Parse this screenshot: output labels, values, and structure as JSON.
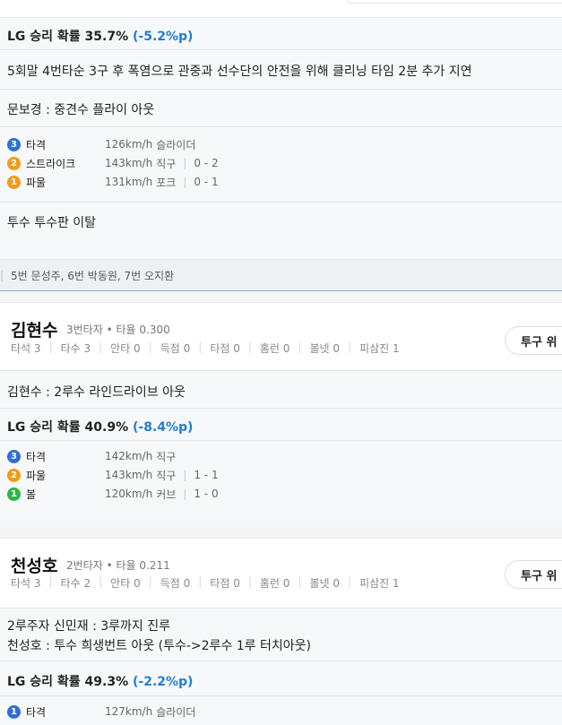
{
  "top_panel": {
    "win_prob": {
      "label": "LG 승리 확률 35.7%",
      "change": "(-5.2%p)"
    },
    "delay_note": "5회말 4번타순 3구 후 폭염으로 관중과 선수단의 안전을 위해 클리닝 타임 2분 추가 지연",
    "play_result": "문보경 : 중견수 플라이 아웃",
    "pitches": [
      {
        "num": "3",
        "color": "#2f6fd6",
        "result": "타격",
        "speed": "126km/h",
        "type": "슬라이더",
        "count": ""
      },
      {
        "num": "2",
        "color": "#f39a17",
        "result": "스트라이크",
        "speed": "143km/h",
        "type": "직구",
        "count": "0 - 2"
      },
      {
        "num": "1",
        "color": "#f39a17",
        "result": "파울",
        "speed": "131km/h",
        "type": "포크",
        "count": "0 - 1"
      }
    ],
    "pitcher_note": "투수 투수판 이탈",
    "footer_lineup": "5번 문성주, 6번 박동원, 7번 오지환"
  },
  "batters": [
    {
      "name": "김현수",
      "meta": "3번타자 • 타율 0.300",
      "stats": [
        "타석 3",
        "타수 3",
        "안타 0",
        "득점 0",
        "타점 0",
        "홈런 0",
        "볼넷 0",
        "피삼진 1"
      ],
      "button": "투구 위",
      "notes": [
        "김현수 : 2루수 라인드라이브 아웃"
      ],
      "win_prob": {
        "label": "LG 승리 확률 40.9%",
        "change": "(-8.4%p)"
      },
      "pitches": [
        {
          "num": "3",
          "color": "#2f6fd6",
          "result": "타격",
          "speed": "142km/h",
          "type": "직구",
          "count": ""
        },
        {
          "num": "2",
          "color": "#f39a17",
          "result": "파울",
          "speed": "143km/h",
          "type": "직구",
          "count": "1 - 1"
        },
        {
          "num": "1",
          "color": "#2fb54a",
          "result": "볼",
          "speed": "120km/h",
          "type": "커브",
          "count": "1 - 0"
        }
      ]
    },
    {
      "name": "천성호",
      "meta": "2번타자 • 타율 0.211",
      "stats": [
        "타석 3",
        "타수 2",
        "안타 0",
        "득점 0",
        "타점 0",
        "홈런 0",
        "볼넷 0",
        "피삼진 1"
      ],
      "button": "투구 위",
      "notes": [
        "2루주자 신민재 : 3루까지 진루",
        "천성호 : 투수 희생번트 아웃 (투수->2루수 1루 터치아웃)"
      ],
      "win_prob": {
        "label": "LG 승리 확률 49.3%",
        "change": "(-2.2%p)"
      },
      "pitches": [
        {
          "num": "1",
          "color": "#2f6fd6",
          "result": "타격",
          "speed": "127km/h",
          "type": "슬라이더",
          "count": ""
        }
      ]
    }
  ]
}
